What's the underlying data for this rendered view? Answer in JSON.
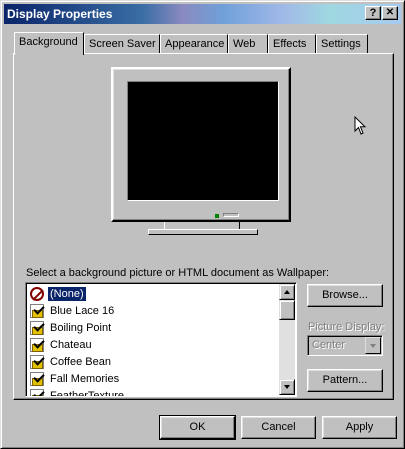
{
  "window": {
    "title": "Display Properties",
    "help_button": "?",
    "close_button": "✕"
  },
  "tabs": [
    {
      "label": "Background",
      "active": true
    },
    {
      "label": "Screen Saver"
    },
    {
      "label": "Appearance"
    },
    {
      "label": "Web"
    },
    {
      "label": "Effects"
    },
    {
      "label": "Settings"
    }
  ],
  "background": {
    "wallpaper_label": "Select a background picture or HTML document as Wallpaper:",
    "items": [
      {
        "label": "(None)",
        "icon": "none-icon",
        "selected": true
      },
      {
        "label": "Blue Lace 16",
        "icon": "wallpaper-icon"
      },
      {
        "label": "Boiling Point",
        "icon": "wallpaper-icon"
      },
      {
        "label": "Chateau",
        "icon": "wallpaper-icon"
      },
      {
        "label": "Coffee Bean",
        "icon": "wallpaper-icon"
      },
      {
        "label": "Fall Memories",
        "icon": "wallpaper-icon"
      },
      {
        "label": "FeatherTexture",
        "icon": "wallpaper-icon"
      }
    ],
    "browse_label": "Browse...",
    "picture_display_label": "Picture Display:",
    "picture_display_value": "Center",
    "pattern_label": "Pattern..."
  },
  "footer": {
    "ok_label": "OK",
    "cancel_label": "Cancel",
    "apply_label": "Apply"
  }
}
